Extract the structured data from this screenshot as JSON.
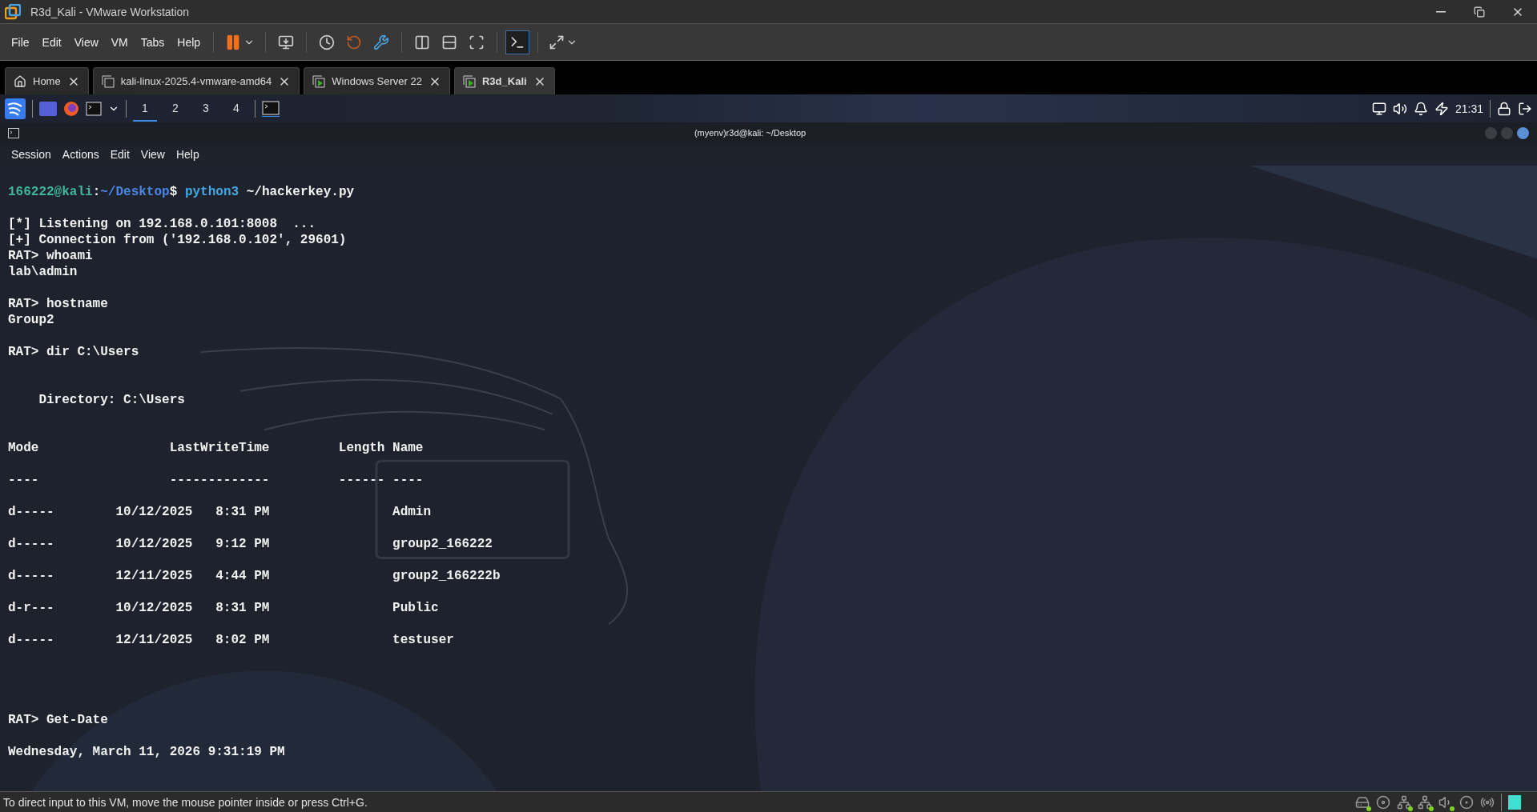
{
  "window": {
    "title": "R3d_Kali - VMware Workstation"
  },
  "menu": [
    "File",
    "Edit",
    "View",
    "VM",
    "Tabs",
    "Help"
  ],
  "tabs": [
    {
      "label": "Home",
      "kind": "home",
      "selected": false
    },
    {
      "label": "kali-linux-2025.4-vmware-amd64",
      "kind": "vm",
      "selected": false
    },
    {
      "label": "Windows Server 22",
      "kind": "running",
      "selected": false
    },
    {
      "label": "R3d_Kali",
      "kind": "running",
      "selected": true
    }
  ],
  "panel": {
    "workspaces": [
      {
        "label": "1",
        "selected": true
      },
      {
        "label": "2",
        "selected": false
      },
      {
        "label": "3",
        "selected": false
      },
      {
        "label": "4",
        "selected": false
      }
    ],
    "clock": "21:31"
  },
  "terminal": {
    "title": "(myenv)r3d@kali: ~/Desktop",
    "menu": [
      "Session",
      "Actions",
      "Edit",
      "View",
      "Help"
    ],
    "prompt": {
      "user": "166222@kali",
      "separator": ":",
      "path": "~/Desktop",
      "symbol": "$",
      "command": "python3",
      "args": "~/hackerkey.py"
    },
    "lines": [
      {
        "kind": "blank"
      },
      {
        "kind": "text",
        "text": "[*] Listening on 192.168.0.101:8008  ..."
      },
      {
        "kind": "text",
        "text": "[+] Connection from ('192.168.0.102', 29601)"
      },
      {
        "kind": "text",
        "text": "RAT> whoami"
      },
      {
        "kind": "text",
        "text": "lab\\admin"
      },
      {
        "kind": "blank"
      },
      {
        "kind": "text",
        "text": "RAT> hostname"
      },
      {
        "kind": "text",
        "text": "Group2"
      },
      {
        "kind": "blank"
      },
      {
        "kind": "text",
        "text": "RAT> dir C:\\Users"
      },
      {
        "kind": "blank"
      },
      {
        "kind": "blank"
      },
      {
        "kind": "text",
        "text": "    Directory: C:\\Users"
      },
      {
        "kind": "blank"
      },
      {
        "kind": "blank"
      },
      {
        "kind": "header",
        "mode": "Mode",
        "last_write_time": "LastWriteTime",
        "length": "Length",
        "name": "Name"
      },
      {
        "kind": "blank"
      },
      {
        "kind": "rule",
        "mode": "----",
        "last_write_time": "-------------",
        "length": "------",
        "name": "----"
      },
      {
        "kind": "blank"
      },
      {
        "kind": "row",
        "mode": "d-----",
        "last_write_time": "10/12/2025   8:31 PM",
        "name": "Admin"
      },
      {
        "kind": "blank"
      },
      {
        "kind": "row",
        "mode": "d-----",
        "last_write_time": "10/12/2025   9:12 PM",
        "name": "group2_166222"
      },
      {
        "kind": "blank"
      },
      {
        "kind": "row",
        "mode": "d-----",
        "last_write_time": "12/11/2025   4:44 PM",
        "name": "group2_166222b"
      },
      {
        "kind": "blank"
      },
      {
        "kind": "row",
        "mode": "d-r---",
        "last_write_time": "10/12/2025   8:31 PM",
        "name": "Public"
      },
      {
        "kind": "blank"
      },
      {
        "kind": "row",
        "mode": "d-----",
        "last_write_time": "12/11/2025   8:02 PM",
        "name": "testuser"
      },
      {
        "kind": "blank"
      },
      {
        "kind": "blank"
      },
      {
        "kind": "blank"
      },
      {
        "kind": "blank"
      },
      {
        "kind": "text",
        "text": "RAT> Get-Date"
      },
      {
        "kind": "blank"
      },
      {
        "kind": "text",
        "text": "Wednesday, March 11, 2026 9:31:19 PM"
      }
    ]
  },
  "status_bar": {
    "message": "To direct input to this VM, move the mouse pointer inside or press Ctrl+G."
  }
}
